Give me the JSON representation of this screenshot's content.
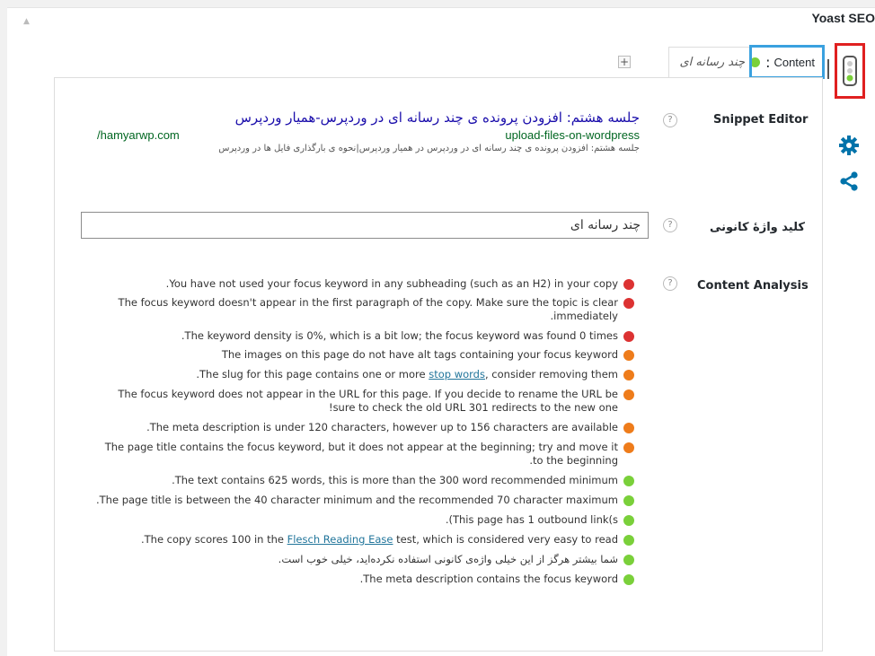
{
  "box": {
    "title": "Yoast SEO"
  },
  "tab": {
    "name": "Content",
    "separator": ":",
    "keyword": "چند رسانه ای",
    "add_label": "+"
  },
  "snippet": {
    "label": "Snippet Editor",
    "title": "جلسه هشتم: افزودن پرونده ی چند رسانه ای در وردپرس-همیار وردپرس",
    "host": "/hamyarwp.com",
    "slug": "upload-files-on-wordpress",
    "description": "جلسه هشتم: افزودن پرونده ی چند رسانه ای در وردپرس در همیار وردپرس|نحوه ی بارگذاری فایل ها در وردپرس"
  },
  "focus": {
    "label": "کلید واژهٔ کانونی",
    "value": "چند رسانه ای"
  },
  "analysis": {
    "label": "Content Analysis",
    "help": "?",
    "colors": {
      "red": "#dc3232",
      "orange": "#ee7c1b",
      "green": "#7ad03a"
    },
    "items": [
      {
        "color": "red",
        "lines": [
          ".You have not used your focus keyword in any subheading (such as an H2) in your copy"
        ]
      },
      {
        "color": "red",
        "lines": [
          "The focus keyword doesn't appear in the first paragraph of the copy. Make sure the topic is clear",
          ".immediately"
        ]
      },
      {
        "color": "red",
        "lines": [
          ".The keyword density is 0%, which is a bit low; the focus keyword was found 0 times"
        ]
      },
      {
        "color": "orange",
        "lines": [
          "The images on this page do not have alt tags containing your focus keyword"
        ]
      },
      {
        "color": "orange",
        "pre": ".The slug for this page contains one or more ",
        "link": "stop words",
        "post": ", consider removing them"
      },
      {
        "color": "orange",
        "lines": [
          "The focus keyword does not appear in the URL for this page. If you decide to rename the URL be",
          "!sure to check the old URL 301 redirects to the new one"
        ]
      },
      {
        "color": "orange",
        "lines": [
          ".The meta description is under 120 characters, however up to 156 characters are available"
        ]
      },
      {
        "color": "orange",
        "lines": [
          "The page title contains the focus keyword, but it does not appear at the beginning; try and move it",
          ".to the beginning"
        ]
      },
      {
        "color": "green",
        "lines": [
          ".The text contains 625 words, this is more than the 300 word recommended minimum"
        ]
      },
      {
        "color": "green",
        "lines": [
          ".The page title is between the 40 character minimum and the recommended 70 character maximum"
        ]
      },
      {
        "color": "green",
        "lines": [
          ".(This page has 1 outbound link(s"
        ]
      },
      {
        "color": "green",
        "pre": ".The copy scores 100 in the ",
        "link": "Flesch Reading Ease",
        "post": " test, which is considered very easy to read"
      },
      {
        "color": "green",
        "rtl": true,
        "lines": [
          "شما بیشتر هرگز از این خیلی واژه‌ی کانونی استفاده نکرده‌اید، خیلی خوب است."
        ]
      },
      {
        "color": "green",
        "lines": [
          ".The meta description contains the focus keyword"
        ]
      }
    ]
  }
}
